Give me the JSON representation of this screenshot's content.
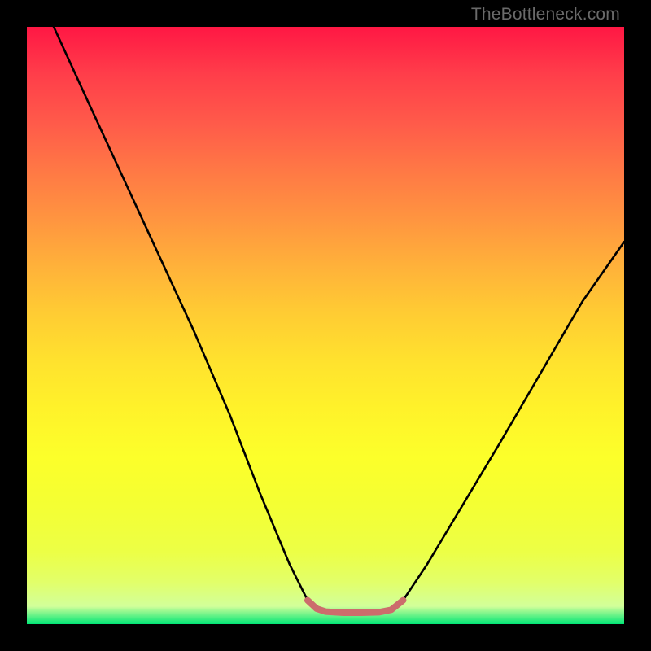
{
  "watermark": "TheBottleneck.com",
  "chart_data": {
    "type": "line",
    "title": "",
    "xlabel": "",
    "ylabel": "",
    "xlim": [
      0,
      100
    ],
    "ylim": [
      0,
      100
    ],
    "grid": false,
    "series": [
      {
        "name": "black-curve",
        "color": "#000000",
        "points": [
          {
            "x": 4.5,
            "y": 100
          },
          {
            "x": 10,
            "y": 88
          },
          {
            "x": 16,
            "y": 75
          },
          {
            "x": 22,
            "y": 62
          },
          {
            "x": 28,
            "y": 49
          },
          {
            "x": 34,
            "y": 35
          },
          {
            "x": 39,
            "y": 22
          },
          {
            "x": 44,
            "y": 10
          },
          {
            "x": 47,
            "y": 4
          },
          {
            "x": 50,
            "y": 2.1
          },
          {
            "x": 55,
            "y": 2.0
          },
          {
            "x": 60,
            "y": 2.1
          },
          {
            "x": 63,
            "y": 4
          },
          {
            "x": 67,
            "y": 10
          },
          {
            "x": 73,
            "y": 20
          },
          {
            "x": 79,
            "y": 30
          },
          {
            "x": 86,
            "y": 42
          },
          {
            "x": 93,
            "y": 54
          },
          {
            "x": 100,
            "y": 64
          }
        ]
      },
      {
        "name": "bottom-highlight",
        "color": "#cc6c6c",
        "points": [
          {
            "x": 47,
            "y": 4.0
          },
          {
            "x": 48.5,
            "y": 2.6
          },
          {
            "x": 50,
            "y": 2.1
          },
          {
            "x": 53,
            "y": 1.9
          },
          {
            "x": 56,
            "y": 1.9
          },
          {
            "x": 59,
            "y": 2.0
          },
          {
            "x": 61,
            "y": 2.4
          },
          {
            "x": 63,
            "y": 4.0
          }
        ]
      }
    ],
    "background_gradient": {
      "top_color": "#ff1744",
      "mid_color": "#ffe22e",
      "bottom_color": "#00e676"
    }
  }
}
